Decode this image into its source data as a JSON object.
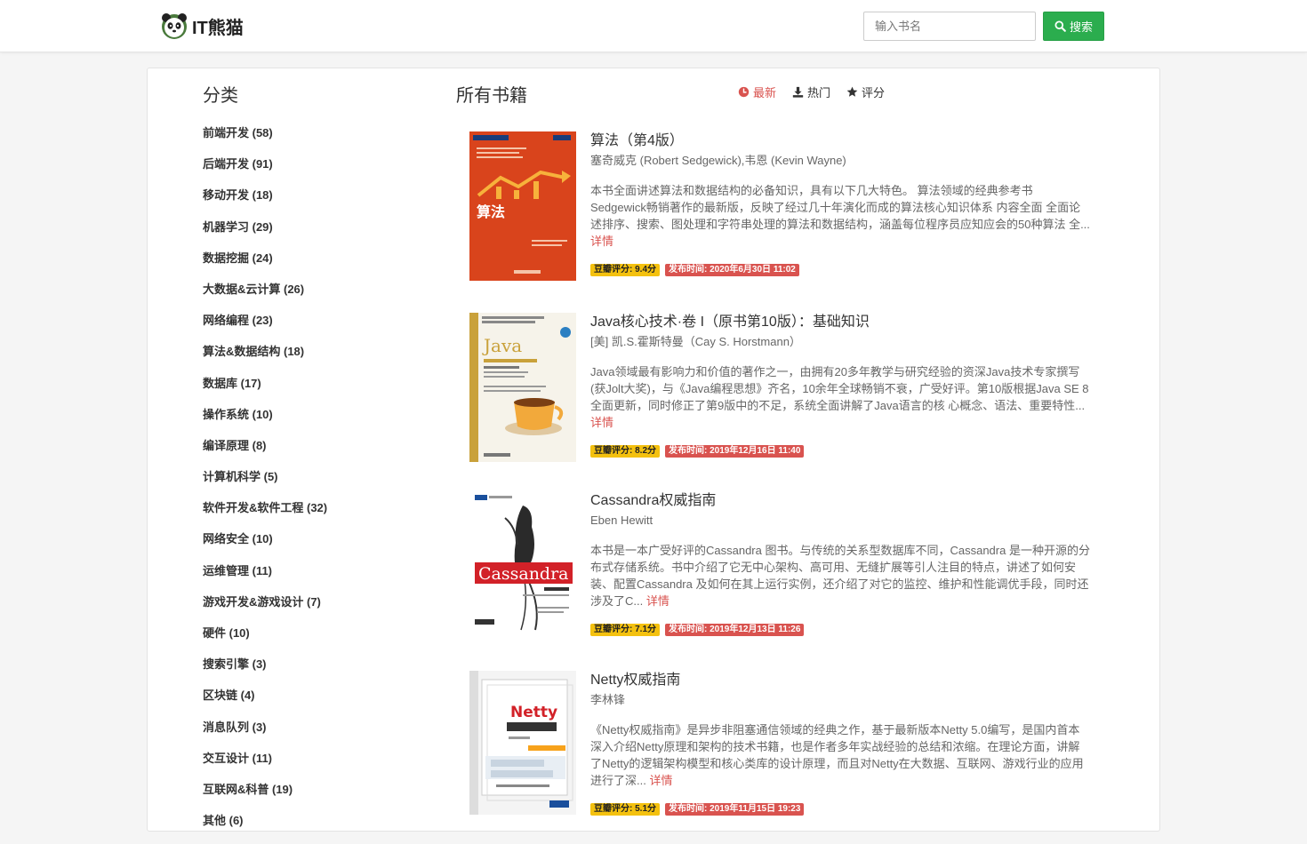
{
  "brand": {
    "name": "IT熊猫"
  },
  "search": {
    "placeholder": "输入书名",
    "button_label": "搜索"
  },
  "sidebar": {
    "title": "分类",
    "categories": [
      "前端开发 (58)",
      "后端开发 (91)",
      "移动开发 (18)",
      "机器学习 (29)",
      "数据挖掘 (24)",
      "大数据&云计算 (26)",
      "网络编程 (23)",
      "算法&数据结构 (18)",
      "数据库 (17)",
      "操作系统 (10)",
      "编译原理 (8)",
      "计算机科学 (5)",
      "软件开发&软件工程 (32)",
      "网络安全 (10)",
      "运维管理 (11)",
      "游戏开发&游戏设计 (7)",
      "硬件 (10)",
      "搜索引擎 (3)",
      "区块链 (4)",
      "消息队列 (3)",
      "交互设计 (11)",
      "互联网&科普 (19)",
      "其他 (6)"
    ]
  },
  "main": {
    "title": "所有书籍",
    "sort": {
      "latest": "最新",
      "hot": "热门",
      "rating": "评分"
    },
    "more_label": "详情",
    "books": [
      {
        "title": "算法（第4版）",
        "author": "塞奇威克 (Robert Sedgewick),韦恩 (Kevin Wayne)",
        "desc": "本书全面讲述算法和数据结构的必备知识，具有以下几大特色。  算法领域的经典参考书 Sedgewick畅销著作的最新版，反映了经过几十年演化而成的算法核心知识体系  内容全面 全面论述排序、搜索、图处理和字符串处理的算法和数据结构，涵盖每位程序员应知应会的50种算法  全...",
        "score": "豆瓣评分: 9.4分",
        "time": "发布时间: 2020年6月30日 11:02",
        "cover_text": "算法"
      },
      {
        "title": "Java核心技术·卷 I（原书第10版）：基础知识",
        "author": "[美] 凯.S.霍斯特曼（Cay S. Horstmann）",
        "desc": "Java领域最有影响力和价值的著作之一，由拥有20多年教学与研究经验的资深Java技术专家撰写(获Jolt大奖)，与《Java编程思想》齐名，10余年全球畅销不衰，广受好评。第10版根据Java SE 8全面更新，同时修正了第9版中的不足，系统全面讲解了Java语言的核 心概念、语法、重要特性...",
        "score": "豆瓣评分: 8.2分",
        "time": "发布时间: 2019年12月16日 11:40",
        "cover_text": "Java"
      },
      {
        "title": "Cassandra权威指南",
        "author": "Eben Hewitt",
        "desc": "本书是一本广受好评的Cassandra 图书。与传统的关系型数据库不同，Cassandra 是一种开源的分布式存储系统。书中介绍了它无中心架构、高可用、无缝扩展等引人注目的特点，讲述了如何安装、配置Cassandra 及如何在其上运行实例，还介绍了对它的监控、维护和性能调优手段，同时还涉及了C...",
        "score": "豆瓣评分: 7.1分",
        "time": "发布时间: 2019年12月13日 11:26",
        "cover_text": "Cassandra"
      },
      {
        "title": "Netty权威指南",
        "author": "李林锋",
        "desc": "《Netty权威指南》是异步非阻塞通信领域的经典之作，基于最新版本Netty 5.0编写，是国内首本深入介绍Netty原理和架构的技术书籍，也是作者多年实战经验的总结和浓缩。在理论方面，讲解了Netty的逻辑架构模型和核心类库的设计原理，而且对Netty在大数据、互联网、游戏行业的应用进行了深...",
        "score": "豆瓣评分: 5.1分",
        "time": "发布时间: 2019年11月15日 19:23",
        "cover_text": "Netty"
      }
    ]
  },
  "colors": {
    "accent_green": "#2bad4e",
    "link_red": "#d9534f",
    "badge_yellow": "#f4c10f"
  }
}
